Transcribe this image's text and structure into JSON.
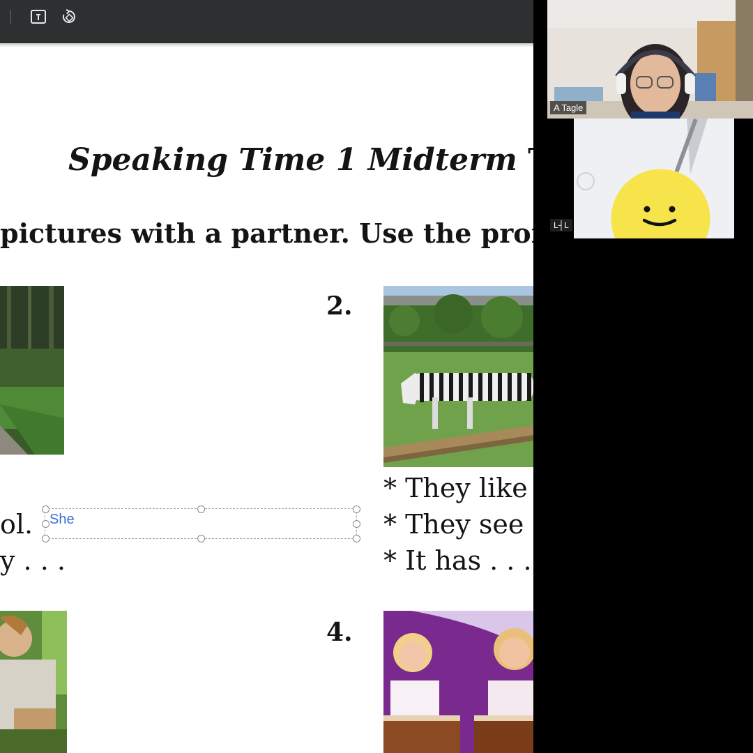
{
  "document": {
    "title_italic": "Speaking Time 1 Midterm",
    "title_regular": " Tes",
    "instruction": "pictures with a partner. Use the promp",
    "items": [
      {
        "number": "2."
      },
      {
        "number": "4."
      }
    ],
    "left_lines": [
      "ol.",
      "y . . ."
    ],
    "item2_prompts": [
      "* They like t",
      "* They see .",
      "* It has . . ."
    ],
    "textbox_value": "She"
  },
  "video": {
    "participant_1_name": "A   Tagle",
    "participant_2_name": "L┤L"
  },
  "colors": {
    "toolbar": "#2d2f31",
    "smiley": "#f7e44a",
    "textbox_text": "#3b6fd4"
  },
  "icons": [
    "page-icon",
    "rotate-icon",
    "smiley-icon"
  ]
}
